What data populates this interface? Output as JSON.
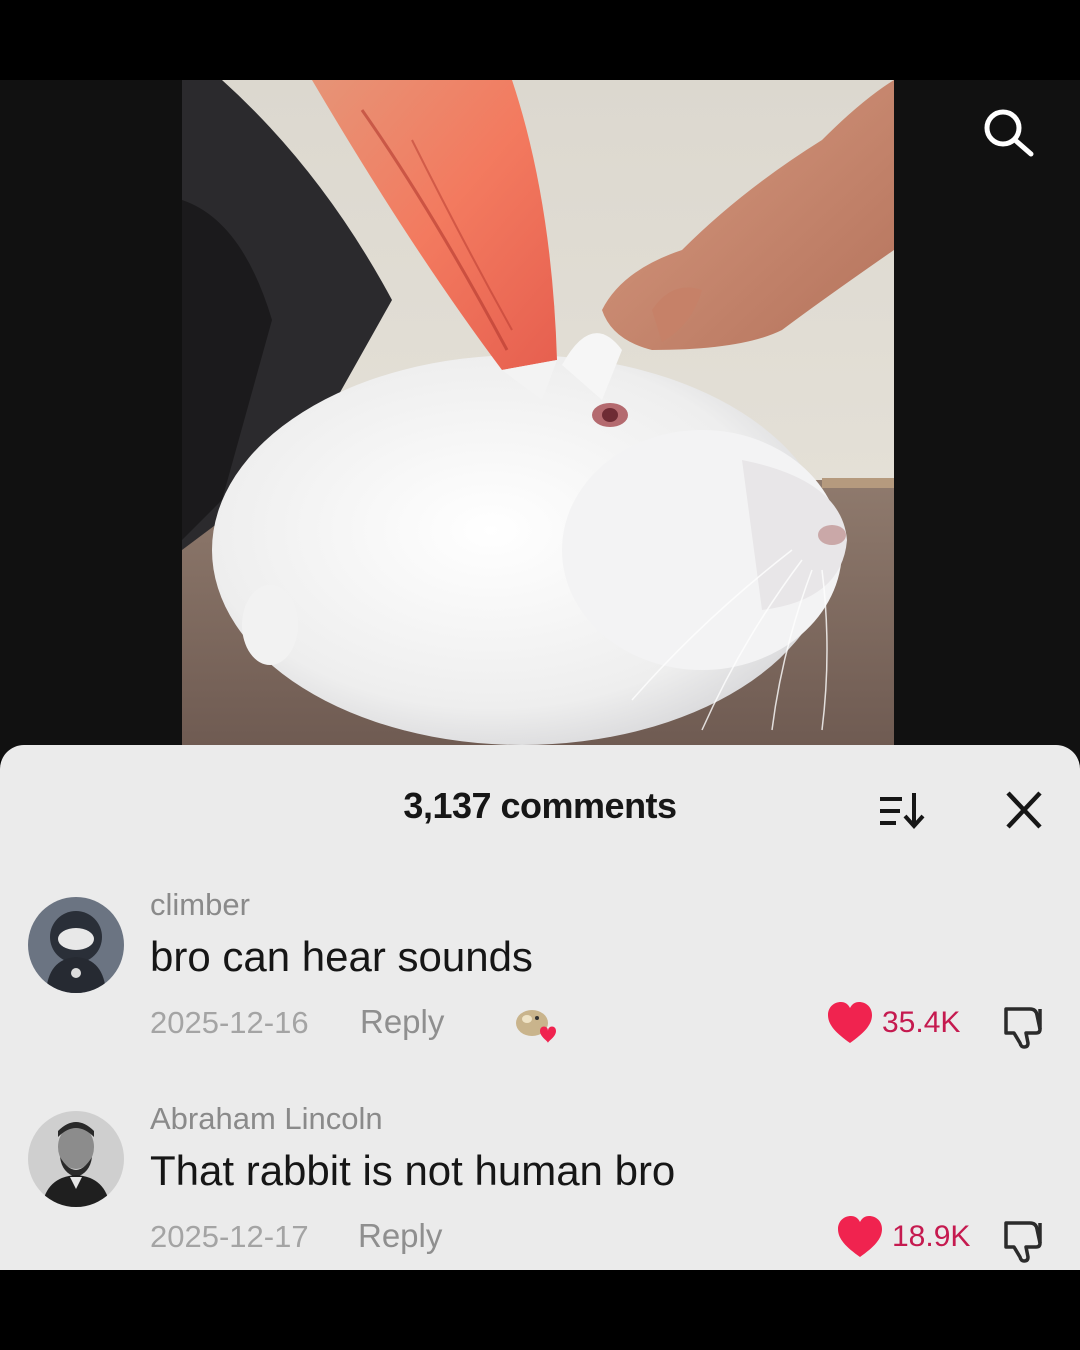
{
  "header": {
    "comment_count_label": "3,137 comments"
  },
  "icons": {
    "search": "search-icon",
    "sort": "sort-icon",
    "close": "close-icon",
    "like": "heart-icon",
    "dislike": "dislike-icon",
    "reaction": "reaction-sticker-icon"
  },
  "colors": {
    "sheet_background": "#ebebeb",
    "like_heart": "#f0234f",
    "like_count": "#c51a4f",
    "muted_text": "#8a8a8a"
  },
  "comments": [
    {
      "username": "climber",
      "text": "bro can hear sounds",
      "date": "2025-12-16",
      "reply_label": "Reply",
      "likes": "35.4K",
      "has_reaction": true
    },
    {
      "username": "Abraham Lincoln",
      "text": "That rabbit is not human bro",
      "date": "2025-12-17",
      "reply_label": "Reply",
      "likes": "18.9K",
      "has_reaction": false
    }
  ]
}
